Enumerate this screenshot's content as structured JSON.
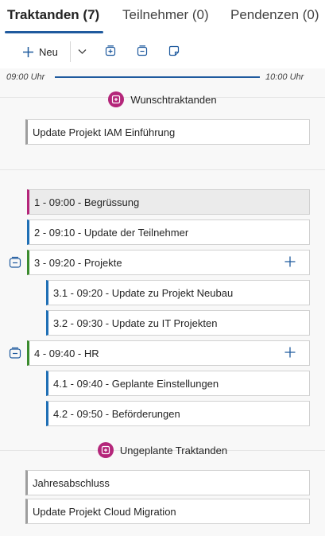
{
  "tabs": [
    {
      "label": "Traktanden (7)"
    },
    {
      "label": "Teilnehmer (0)"
    },
    {
      "label": "Pendenzen (0)"
    }
  ],
  "toolbar": {
    "new_label": "Neu",
    "icons": [
      "plus-icon",
      "chevron-down-icon",
      "expand-all-icon",
      "collapse-all-icon",
      "sticky-note-icon"
    ]
  },
  "timeline": {
    "start": "09:00 Uhr",
    "end": "10:00 Uhr"
  },
  "wunsch": {
    "title": "Wunschtraktanden",
    "items": [
      {
        "label": "Update Projekt IAM Einführung"
      }
    ]
  },
  "agenda": {
    "items": [
      {
        "label": "1 - 09:00 - Begrüssung"
      },
      {
        "label": "2 - 09:10 - Update der Teilnehmer"
      },
      {
        "label": "3 - 09:20 - Projekte"
      },
      {
        "label": "3.1 - 09:20 - Update zu Projekt Neubau"
      },
      {
        "label": "3.2 - 09:30 - Update zu IT Projekten"
      },
      {
        "label": "4 - 09:40 - HR"
      },
      {
        "label": "4.1 - 09:40 - Geplante Einstellungen"
      },
      {
        "label": "4.2 - 09:50 - Beförderungen"
      }
    ]
  },
  "ungeplant": {
    "title": "Ungeplante Traktanden",
    "items": [
      {
        "label": "Jahresabschluss"
      },
      {
        "label": "Update Projekt Cloud Migration"
      }
    ]
  },
  "colors": {
    "accent": "#1f5a9e",
    "magenta": "#b4267a",
    "green": "#3b8b2e",
    "blue": "#1f6fb5",
    "gray": "#9e9e9e"
  }
}
